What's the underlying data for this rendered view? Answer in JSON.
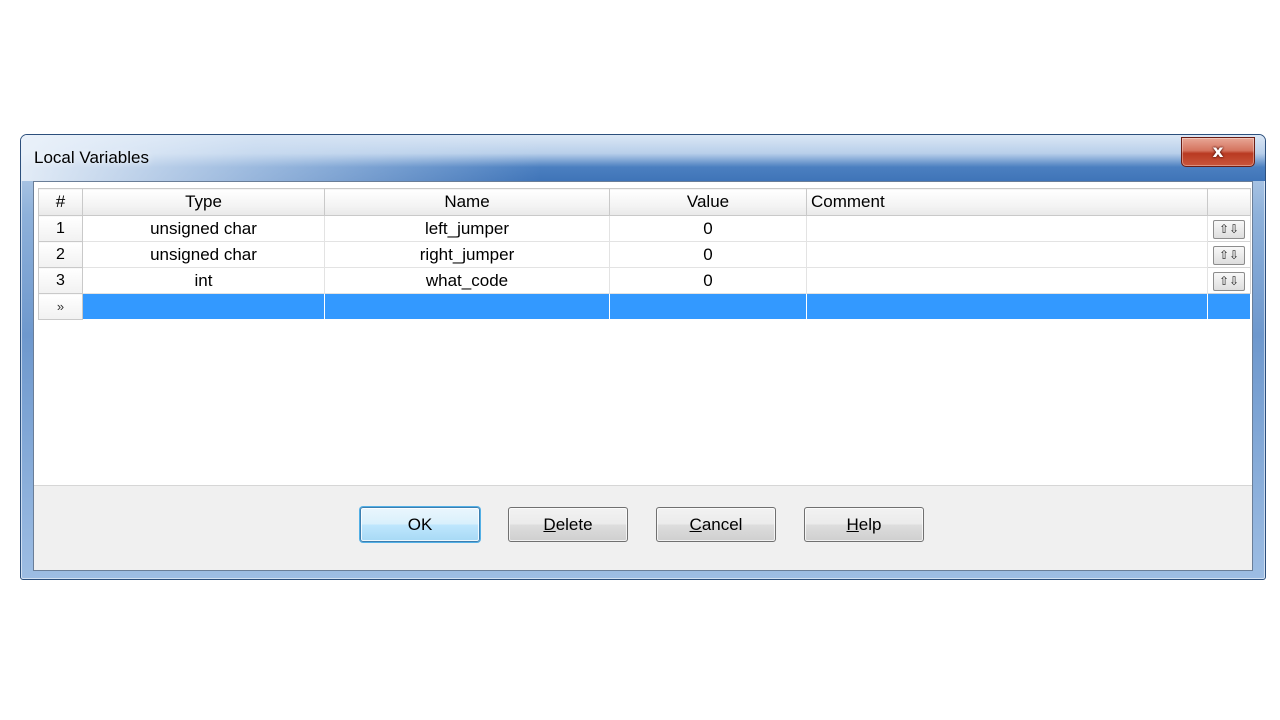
{
  "window": {
    "title": "Local Variables",
    "close_glyph": "x"
  },
  "grid": {
    "columns": [
      "#",
      "Type",
      "Name",
      "Value",
      "Comment",
      ""
    ],
    "rows": [
      {
        "num": "1",
        "type": "unsigned char",
        "name": "left_jumper",
        "value": "0",
        "comment": "",
        "action_glyph": "⇧⇩"
      },
      {
        "num": "2",
        "type": "unsigned char",
        "name": "right_jumper",
        "value": "0",
        "comment": "",
        "action_glyph": "⇧⇩"
      },
      {
        "num": "3",
        "type": "int",
        "name": "what_code",
        "value": "0",
        "comment": "",
        "action_glyph": "⇧⇩"
      }
    ],
    "new_row_marker": "»",
    "selection_color": "#3399ff"
  },
  "buttons": {
    "ok": {
      "label": "OK"
    },
    "delete": {
      "accel": "D",
      "rest": "elete"
    },
    "cancel": {
      "accel": "C",
      "rest": "ancel"
    },
    "help": {
      "accel": "H",
      "rest": "elp"
    }
  }
}
